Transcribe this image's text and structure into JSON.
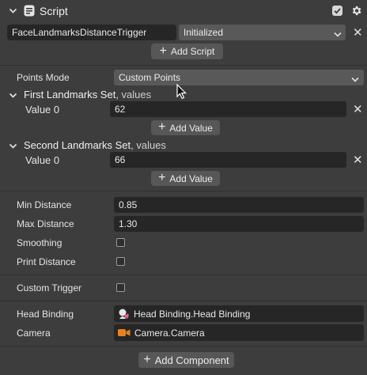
{
  "header": {
    "title": "Script",
    "enabled": true
  },
  "script_row": {
    "script_name": "FaceLandmarksDistanceTrigger",
    "status": "Initialized",
    "add_script_label": "Add Script"
  },
  "points_mode": {
    "label": "Points Mode",
    "value": "Custom Points"
  },
  "first_set": {
    "title": "First Landmarks Set",
    "subtitle": ", values",
    "item_label": "Value 0",
    "item_value": "62",
    "add_label": "Add Value"
  },
  "second_set": {
    "title": "Second Landmarks Set",
    "subtitle": ", values",
    "item_label": "Value 0",
    "item_value": "66",
    "add_label": "Add Value"
  },
  "distance": {
    "min_label": "Min Distance",
    "min_value": "0.85",
    "max_label": "Max Distance",
    "max_value": "1.30",
    "smoothing_label": "Smoothing",
    "smoothing_checked": false,
    "print_label": "Print Distance",
    "print_checked": false
  },
  "custom_trigger": {
    "label": "Custom Trigger",
    "checked": false
  },
  "bindings": {
    "head_label": "Head Binding",
    "head_value": "Head Binding.Head Binding",
    "camera_label": "Camera",
    "camera_value": "Camera.Camera"
  },
  "footer": {
    "add_component_label": "Add Component"
  },
  "colors": {
    "panel": "#3d3d3d",
    "field": "#262626",
    "button": "#575757",
    "camera_icon": "#e8821e"
  }
}
